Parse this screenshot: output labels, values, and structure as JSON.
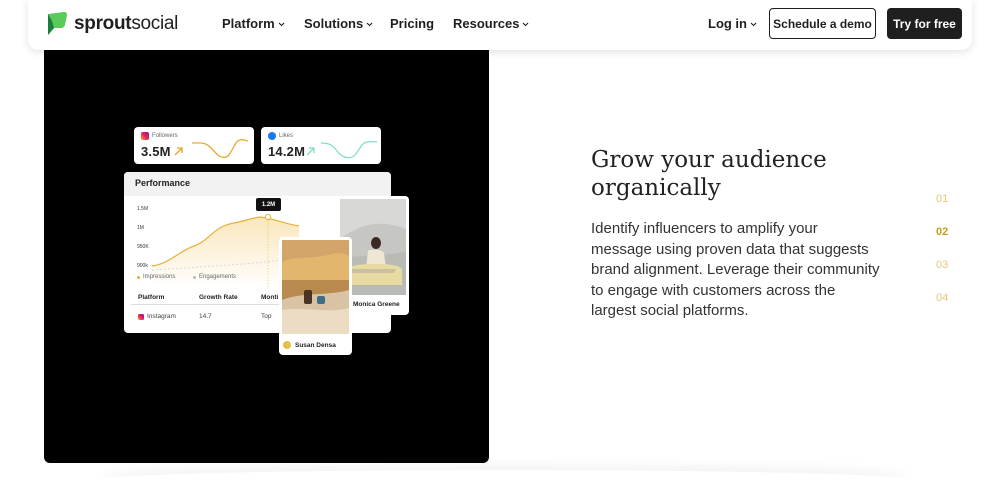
{
  "header": {
    "logo": {
      "bold": "sprout",
      "thin": "social",
      "color": "#59cb59"
    },
    "nav": [
      {
        "label": "Platform",
        "has_dropdown": true
      },
      {
        "label": "Solutions",
        "has_dropdown": true
      },
      {
        "label": "Pricing",
        "has_dropdown": false
      },
      {
        "label": "Resources",
        "has_dropdown": true
      }
    ],
    "login": {
      "label": "Log in",
      "has_dropdown": true
    },
    "demo_button": "Schedule a demo",
    "trial_button": "Try for free"
  },
  "media": {
    "followers_card": {
      "label": "Followers",
      "value": "3.5M",
      "icon": "instagram-icon",
      "trend": "up",
      "color": "#e7a422"
    },
    "likes_card": {
      "label": "Likes",
      "value": "14.2M",
      "icon": "facebook-icon",
      "trend": "up",
      "color": "#7fdcc8"
    },
    "performance": {
      "title": "Performance",
      "y_ticks": [
        "1.5M",
        "1M",
        "950K",
        "900k"
      ],
      "tooltip": "1.2M",
      "legend": [
        "Impressions",
        "Engagements"
      ],
      "columns": [
        "Platform",
        "Growth Rate",
        "Monti"
      ],
      "row": {
        "platform": "Instagram",
        "growth_rate": "14.7",
        "month": "Top"
      }
    },
    "profiles": [
      {
        "name": "Monica Greene"
      },
      {
        "name": "Susan Densa"
      }
    ]
  },
  "content": {
    "headline": "Grow your audience organically",
    "body": "Identify influencers to amplify your message using proven data that suggests brand alignment. Leverage their community to engage with customers across the largest social platforms.",
    "steps": [
      "01",
      "02",
      "03",
      "04"
    ],
    "active_step": "02"
  },
  "colors": {
    "accent": "#c89d1d",
    "accent_light": "#e6c77a",
    "dark": "#1f1f1f",
    "brand_green": "#59cb59"
  }
}
